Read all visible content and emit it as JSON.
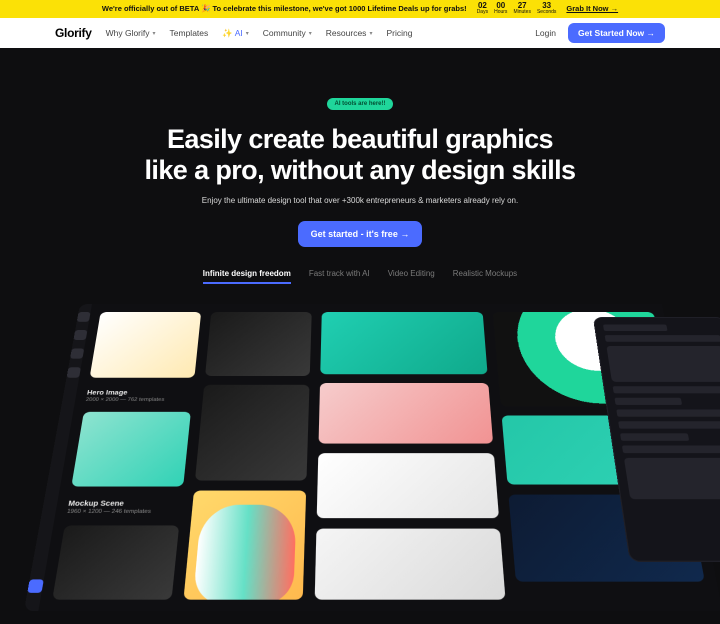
{
  "promo": {
    "text": "We're officially out of BETA 🎉 To celebrate this milestone, we've got 1000 Lifetime Deals up for grabs!",
    "countdown": [
      {
        "n": "02",
        "l": "Days"
      },
      {
        "n": "00",
        "l": "Hours"
      },
      {
        "n": "27",
        "l": "Minutes"
      },
      {
        "n": "33",
        "l": "Seconds"
      }
    ],
    "cta": "Grab It Now →"
  },
  "nav": {
    "logo": "Glorify",
    "items": [
      {
        "label": "Why Glorify",
        "drop": true
      },
      {
        "label": "Templates"
      },
      {
        "label": "✨ AI",
        "drop": true,
        "accent": true
      },
      {
        "label": "Community",
        "drop": true
      },
      {
        "label": "Resources",
        "drop": true
      },
      {
        "label": "Pricing"
      }
    ],
    "login": "Login",
    "cta": "Get Started Now →"
  },
  "hero": {
    "pill": "AI tools are here!!",
    "h1_line1": "Easily create beautiful graphics",
    "h1_line2": "like a pro, without any design skills",
    "sub": "Enjoy the ultimate design tool that over +300k entrepreneurs & marketers already rely on.",
    "cta": "Get started - it's free →"
  },
  "tabs": [
    {
      "label": "Infinite design freedom",
      "active": true
    },
    {
      "label": "Fast track with AI"
    },
    {
      "label": "Video Editing"
    },
    {
      "label": "Realistic Mockups"
    }
  ],
  "gallery": {
    "hero_image": {
      "title": "Hero Image",
      "meta": "2000 × 2000 — 762 templates"
    },
    "mockup_scene": {
      "title": "Mockup Scene",
      "meta": "1960 × 1200 — 246 templates"
    }
  }
}
